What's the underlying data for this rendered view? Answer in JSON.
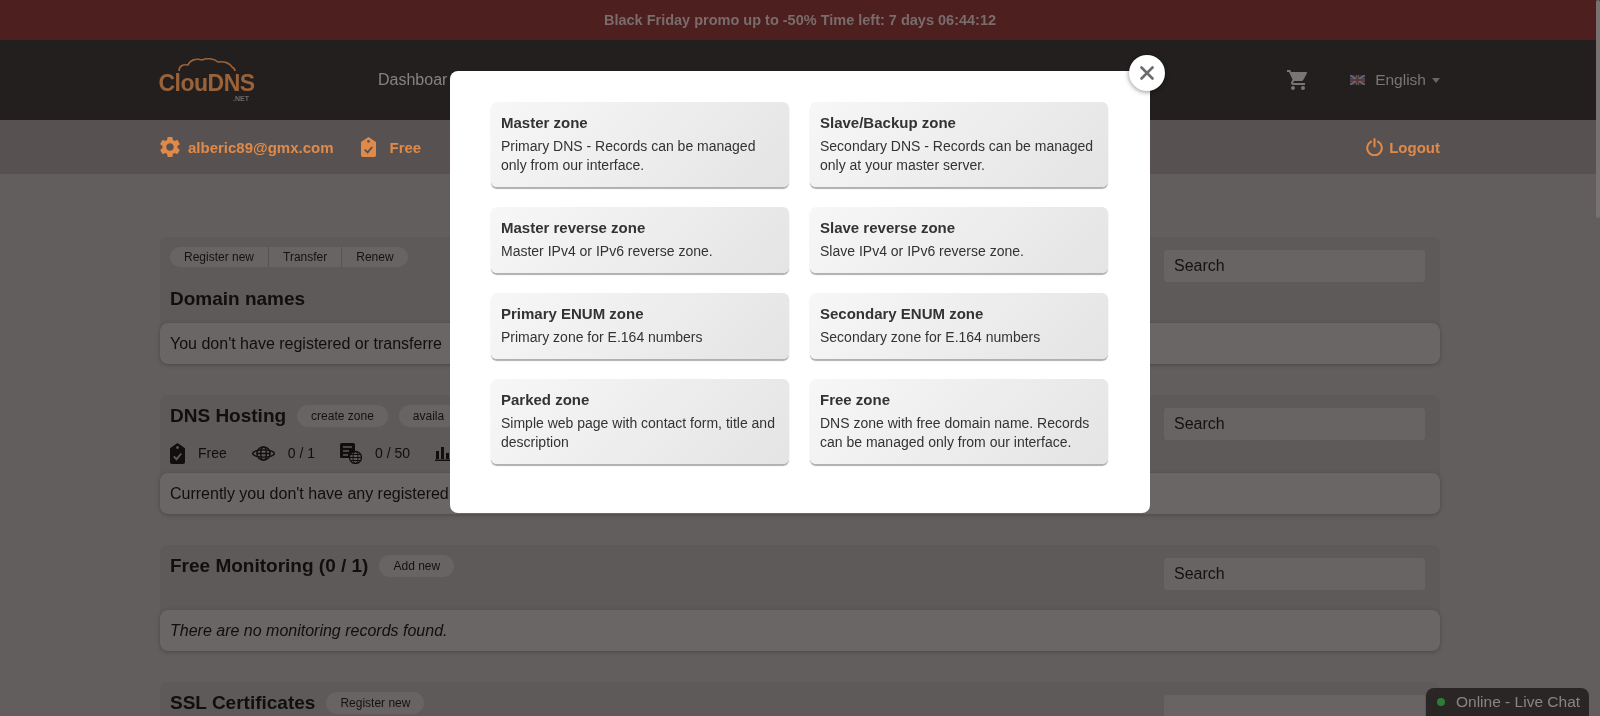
{
  "promo_bar": {
    "text": "Black Friday promo up to -50% Time left: 7 days 06:44:12"
  },
  "header": {
    "logo": {
      "name": "ClouDNS",
      "suffix": ".NET"
    },
    "nav": [
      {
        "label": "Dashboar"
      }
    ],
    "language": "English"
  },
  "user_bar": {
    "email": "alberic89@gmx.com",
    "plan": "Free",
    "logout": "Logout"
  },
  "sections": [
    {
      "title": "Domain names",
      "kind": "segmented",
      "actions": [
        "Register new",
        "Transfer",
        "Renew"
      ],
      "search": {
        "placeholder": "Search"
      },
      "message": {
        "text": "You don't have registered or transferre",
        "italic": false
      }
    },
    {
      "title": "DNS Hosting",
      "kind": "inline",
      "actions": [
        "create zone",
        "availa"
      ],
      "stats": [
        {
          "kind": "plan",
          "value": "Free"
        },
        {
          "kind": "zones",
          "value": "0 / 1"
        },
        {
          "kind": "records",
          "value": "0 / 50"
        },
        {
          "kind": "statistics"
        }
      ],
      "search": {
        "placeholder": "Search"
      },
      "message": {
        "text": "Currently you don't have any registered",
        "italic": false
      }
    },
    {
      "title": "Free Monitoring (0 / 1)",
      "kind": "inline",
      "actions": [
        "Add new"
      ],
      "search": {
        "placeholder": "Search"
      },
      "message": {
        "text": "There are no monitoring records found.",
        "italic": true
      }
    },
    {
      "title": "SSL Certificates",
      "kind": "inline",
      "actions": [
        "Register new"
      ],
      "search": {
        "visible": true
      }
    }
  ],
  "modal": {
    "options": [
      {
        "title": "Master zone",
        "description": "Primary DNS - Records can be managed only from our interface."
      },
      {
        "title": "Slave/Backup zone",
        "description": "Secondary DNS - Records can be managed only at your master server."
      },
      {
        "title": "Master reverse zone",
        "description": "Master IPv4 or IPv6 reverse zone."
      },
      {
        "title": "Slave reverse zone",
        "description": "Slave IPv4 or IPv6 reverse zone."
      },
      {
        "title": "Primary ENUM zone",
        "description": "Primary zone for E.164 numbers"
      },
      {
        "title": "Secondary ENUM zone",
        "description": "Secondary zone for E.164 numbers"
      },
      {
        "title": "Parked zone",
        "description": "Simple web page with contact form, title and description"
      },
      {
        "title": "Free zone",
        "description": "DNS zone with free domain name. Records can be managed only from our interface."
      }
    ]
  },
  "live_chat": {
    "label": "Online - Live Chat",
    "online": true
  }
}
